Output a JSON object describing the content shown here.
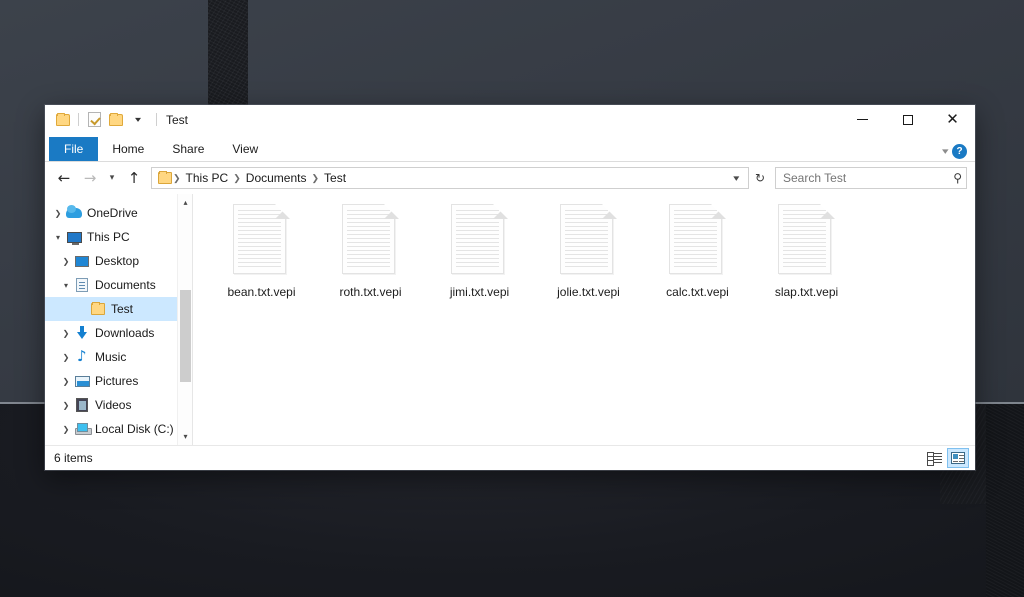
{
  "window": {
    "title": "Test",
    "quick_access": [
      {
        "name": "folder-icon",
        "label": ""
      },
      {
        "name": "properties-icon",
        "label": ""
      },
      {
        "name": "new-folder-icon",
        "label": ""
      },
      {
        "name": "customize-caret-icon",
        "label": ""
      }
    ],
    "controls": {
      "minimize": "Minimize",
      "maximize": "Maximize",
      "close": "Close"
    }
  },
  "ribbon": {
    "tabs": [
      {
        "label": "File",
        "active": true
      },
      {
        "label": "Home",
        "active": false
      },
      {
        "label": "Share",
        "active": false
      },
      {
        "label": "View",
        "active": false
      }
    ],
    "expand_icon": "chevron-down-icon",
    "help_label": "?"
  },
  "navigation": {
    "back_label": "←",
    "forward_label": "→",
    "recent_label": "⌵",
    "up_label": "↑",
    "breadcrumbs": [
      "This PC",
      "Documents",
      "Test"
    ],
    "breadcrumb_separator": "›",
    "address_caret": "⌵",
    "refresh_label": "↻"
  },
  "search": {
    "placeholder": "Search Test",
    "value": "",
    "icon": "search-icon"
  },
  "sidebar": {
    "scrollbar": {
      "up": "⌵",
      "down": "⌵"
    },
    "items": [
      {
        "label": "OneDrive",
        "icon": "cloud-icon",
        "chevron": "›",
        "indent": 0,
        "selected": false
      },
      {
        "label": "This PC",
        "icon": "monitor-icon",
        "chevron": "⌄",
        "indent": 0,
        "selected": false
      },
      {
        "label": "Desktop",
        "icon": "desktop-icon",
        "chevron": "›",
        "indent": 1,
        "selected": false
      },
      {
        "label": "Documents",
        "icon": "document-icon",
        "chevron": "⌄",
        "indent": 1,
        "selected": false
      },
      {
        "label": "Test",
        "icon": "folder-icon",
        "chevron": "",
        "indent": 2,
        "selected": true
      },
      {
        "label": "Downloads",
        "icon": "download-icon",
        "chevron": "›",
        "indent": 1,
        "selected": false
      },
      {
        "label": "Music",
        "icon": "music-icon",
        "chevron": "›",
        "indent": 1,
        "selected": false
      },
      {
        "label": "Pictures",
        "icon": "picture-icon",
        "chevron": "›",
        "indent": 1,
        "selected": false
      },
      {
        "label": "Videos",
        "icon": "video-icon",
        "chevron": "›",
        "indent": 1,
        "selected": false
      },
      {
        "label": "Local Disk (C:)",
        "icon": "disk-icon",
        "chevron": "›",
        "indent": 1,
        "selected": false
      }
    ]
  },
  "files": [
    {
      "name": "bean.txt.vepi",
      "icon": "text-document-icon"
    },
    {
      "name": "roth.txt.vepi",
      "icon": "text-document-icon"
    },
    {
      "name": "jimi.txt.vepi",
      "icon": "text-document-icon"
    },
    {
      "name": "jolie.txt.vepi",
      "icon": "text-document-icon"
    },
    {
      "name": "calc.txt.vepi",
      "icon": "text-document-icon"
    },
    {
      "name": "slap.txt.vepi",
      "icon": "text-document-icon"
    }
  ],
  "statusbar": {
    "item_count": "6 items",
    "views": [
      {
        "name": "details-view-button",
        "active": false
      },
      {
        "name": "large-icons-view-button",
        "active": true
      }
    ]
  },
  "colors": {
    "accent": "#1a7ac4",
    "selection": "#cce8ff",
    "window_bg": "#ffffff",
    "desktop_upper": "#373d46",
    "desktop_lower": "#191b21",
    "folder_yellow": "#ffd782"
  }
}
